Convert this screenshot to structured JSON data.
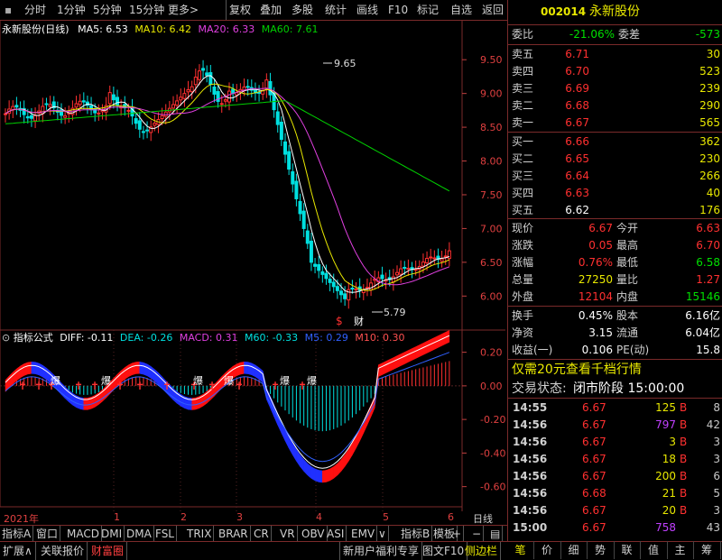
{
  "toolbar": {
    "items": [
      "分时",
      "1分钟",
      "5分钟",
      "15分钟",
      "更多>",
      "复权",
      "叠加",
      "多股",
      "统计",
      "画线",
      "F10",
      "标记",
      "自选",
      "返回"
    ]
  },
  "stock": {
    "code": "002014",
    "name": "永新股份",
    "title": "永新股份(日线)"
  },
  "ma_legend": {
    "ma5": "MA5: 6.53",
    "ma10": "MA10: 6.42",
    "ma20": "MA20: 6.33",
    "ma60": "MA60: 7.61",
    "colors": {
      "ma5": "#ffffff",
      "ma10": "#e8e800",
      "ma20": "#e040e0",
      "ma60": "#00d000"
    }
  },
  "annotations": {
    "high": "9.65",
    "low": "5.79",
    "fin": "财",
    "dollar": "$",
    "bao": "爆"
  },
  "indicator_legend": {
    "name": "指标公式",
    "diff": "DIFF: -0.11",
    "dea": "DEA: -0.26",
    "macd": "MACD: 0.31",
    "m60": "M60: -0.33",
    "m5": "M5: 0.29",
    "m10": "M10: 0.30"
  },
  "axis": {
    "price_ticks": [
      "9.50",
      "9.00",
      "8.50",
      "8.00",
      "7.50",
      "7.00",
      "6.50",
      "6.00"
    ],
    "ind_ticks": [
      "0.20",
      "0.00",
      "-0.20",
      "-0.40",
      "-0.60"
    ],
    "dates": [
      "2021年",
      "1",
      "2",
      "3",
      "4",
      "5",
      "6"
    ],
    "day_label": "日线"
  },
  "quote": {
    "weibi_label": "委比",
    "weibi": "-21.06%",
    "weicha_label": "委差",
    "weicha": "-573",
    "asks": [
      {
        "label": "卖五",
        "price": "6.71",
        "vol": "30"
      },
      {
        "label": "卖四",
        "price": "6.70",
        "vol": "523"
      },
      {
        "label": "卖三",
        "price": "6.69",
        "vol": "239"
      },
      {
        "label": "卖二",
        "price": "6.68",
        "vol": "290"
      },
      {
        "label": "卖一",
        "price": "6.67",
        "vol": "565"
      }
    ],
    "bids": [
      {
        "label": "买一",
        "price": "6.66",
        "vol": "362"
      },
      {
        "label": "买二",
        "price": "6.65",
        "vol": "230"
      },
      {
        "label": "买三",
        "price": "6.64",
        "vol": "266"
      },
      {
        "label": "买四",
        "price": "6.63",
        "vol": "40"
      },
      {
        "label": "买五",
        "price": "6.62",
        "vol": "176"
      }
    ],
    "stats1": [
      {
        "l": "现价",
        "v": "6.67",
        "l2": "今开",
        "v2": "6.63"
      },
      {
        "l": "涨跌",
        "v": "0.05",
        "l2": "最高",
        "v2": "6.70"
      },
      {
        "l": "涨幅",
        "v": "0.76%",
        "l2": "最低",
        "v2": "6.58"
      },
      {
        "l": "总量",
        "v": "27250",
        "l2": "量比",
        "v2": "1.27"
      },
      {
        "l": "外盘",
        "v": "12104",
        "l2": "内盘",
        "v2": "15146"
      }
    ],
    "stats2": [
      {
        "l": "换手",
        "v": "0.45%",
        "l2": "股本",
        "v2": "6.16亿"
      },
      {
        "l": "净资",
        "v": "3.15",
        "l2": "流通",
        "v2": "6.04亿"
      },
      {
        "l": "收益(一)",
        "v": "0.106",
        "l2": "PE(动)",
        "v2": "15.8"
      }
    ],
    "promo": "仅需20元查看千档行情",
    "trade_status_label": "交易状态:",
    "trade_status": "闭市阶段 15:00:00"
  },
  "trades": [
    {
      "t": "14:55",
      "p": "6.67",
      "v": "125",
      "f": "B",
      "n": "8",
      "vc": "yellow"
    },
    {
      "t": "14:56",
      "p": "6.67",
      "v": "797",
      "f": "B",
      "n": "42",
      "vc": "purple"
    },
    {
      "t": "14:56",
      "p": "6.67",
      "v": "3",
      "f": "B",
      "n": "3",
      "vc": "yellow"
    },
    {
      "t": "14:56",
      "p": "6.67",
      "v": "18",
      "f": "B",
      "n": "3",
      "vc": "yellow"
    },
    {
      "t": "14:56",
      "p": "6.67",
      "v": "200",
      "f": "B",
      "n": "6",
      "vc": "yellow"
    },
    {
      "t": "14:56",
      "p": "6.68",
      "v": "21",
      "f": "B",
      "n": "5",
      "vc": "yellow"
    },
    {
      "t": "14:56",
      "p": "6.67",
      "v": "20",
      "f": "B",
      "n": "3",
      "vc": "yellow"
    },
    {
      "t": "15:00",
      "p": "6.67",
      "v": "758",
      "f": "",
      "n": "43",
      "vc": "purple"
    }
  ],
  "indicator_tabs": [
    "指标A",
    "窗口",
    "MACD",
    "DMI",
    "DMA",
    "FSL",
    "TRIX",
    "BRAR",
    "CR",
    "VR",
    "OBV",
    "ASI",
    "EMV",
    "∨",
    "指标B",
    "模板",
    "+",
    "−",
    "▤"
  ],
  "status_bar": {
    "expand": "扩展∧",
    "watch": "关联报价",
    "wealth": "财富圈",
    "promo": "新用户福利专享",
    "f10": "图文F10",
    "sidebar": "侧边栏"
  },
  "right_tabs": [
    "笔",
    "价",
    "细",
    "势",
    "联",
    "值",
    "主",
    "筹"
  ]
}
